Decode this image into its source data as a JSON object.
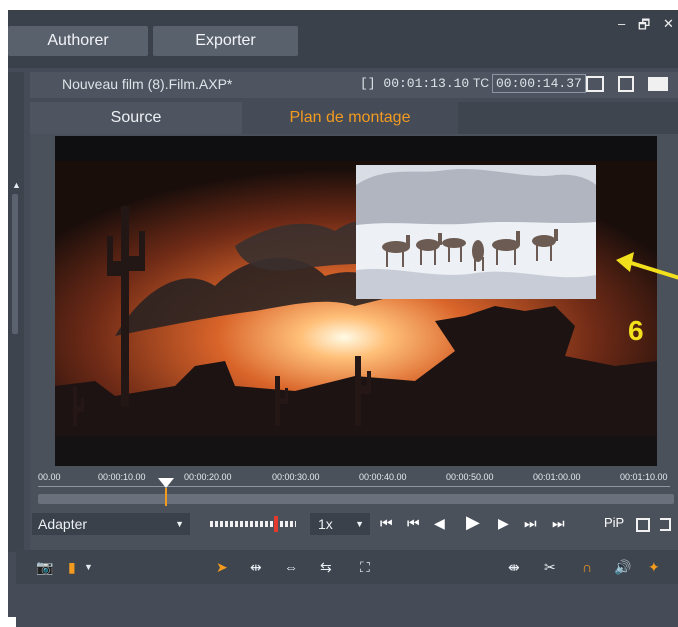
{
  "header": {
    "tabs": [
      "Authorer",
      "Exporter"
    ],
    "window_controls": {
      "minimize": "–",
      "restore": "🗗",
      "close": "✕"
    }
  },
  "project": {
    "title": "Nouveau film (8).Film.AXP*",
    "duration_label": "[] 00:01:13.10",
    "tc_label": "TC",
    "tc_value": "00:00:14.37"
  },
  "tabs": {
    "source": "Source",
    "montage": "Plan de montage"
  },
  "timeline": {
    "ticks": [
      "00.00",
      "00:00:10.00",
      "00:00:20.00",
      "00:00:30.00",
      "00:00:40.00",
      "00:00:50.00",
      "00:01:00.00",
      "00:01:10.00"
    ]
  },
  "controls": {
    "fit_label": "Adapter",
    "speed_label": "1x",
    "pip_label": "PiP"
  },
  "annotation": {
    "number": "6"
  },
  "icons": {
    "camera": "camera-icon",
    "marker": "marker-icon",
    "pointer": "pointer-icon",
    "split": "split-icon",
    "zoom": "zoom-icon"
  },
  "colors": {
    "accent": "#f39a1f",
    "panel": "#454c57",
    "dark": "#3a414b",
    "annotation_yellow": "#f2e01c"
  }
}
